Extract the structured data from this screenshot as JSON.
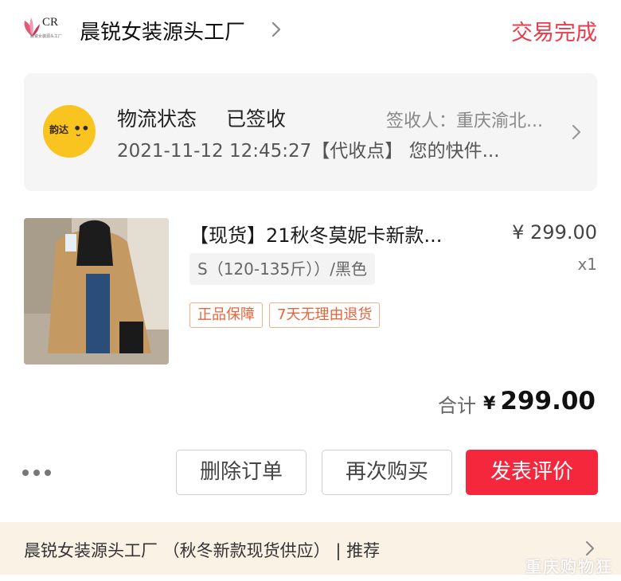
{
  "header": {
    "shop_logo_text": "CR",
    "shop_logo_subtext": "晨锐女装源头工厂",
    "shop_name": "晨锐女装源头工厂",
    "order_status": "交易完成"
  },
  "logistics": {
    "courier_brand": "韵达",
    "status_label": "物流状态",
    "status_value": "已签收",
    "receiver": "签收人：重庆渝北...",
    "detail": "2021-11-12 12:45:27【代收点】 您的快件..."
  },
  "product": {
    "title": "【现货】21秋冬莫妮卡新款...",
    "price": "¥ 299.00",
    "sku": "S（120-135斤））/黑色",
    "quantity": "x1",
    "tags": [
      "正品保障",
      "7天无理由退货"
    ]
  },
  "total": {
    "label": "合计",
    "currency": "¥",
    "amount": "299.00"
  },
  "actions": {
    "delete_label": "删除订单",
    "rebuy_label": "再次购买",
    "review_label": "发表评价"
  },
  "recommend": {
    "text": "晨锐女装源头工厂 （秋冬新款现货供应） | 推荐"
  },
  "watermark": "重庆购物狂",
  "colors": {
    "accent_red": "#f5273d",
    "status_red": "#ec3b4b",
    "tag_orange": "#e8643c",
    "courier_yellow": "#f9c41f",
    "recommend_bg": "#fbf2e6"
  },
  "icons": {
    "shop_chevron": "chevron-right-icon",
    "logistics_chevron": "chevron-right-icon",
    "more": "more-dots-icon"
  }
}
